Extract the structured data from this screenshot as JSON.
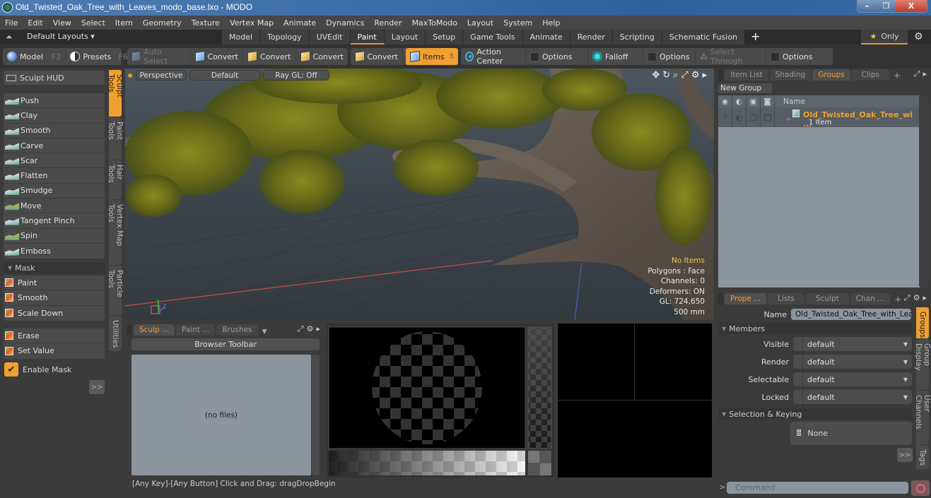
{
  "window": {
    "title": "Old_Twisted_Oak_Tree_with_Leaves_modo_base.lxo - MODO",
    "controls": {
      "minimize": "–",
      "maximize": "❐",
      "close": "X"
    }
  },
  "menu": [
    "File",
    "Edit",
    "View",
    "Select",
    "Item",
    "Geometry",
    "Texture",
    "Vertex Map",
    "Animate",
    "Dynamics",
    "Render",
    "MaxToModo",
    "Layout",
    "System",
    "Help"
  ],
  "layout_bar": {
    "layouts_label": "Default Layouts ▾",
    "tabs": [
      "Model",
      "Topology",
      "UVEdit",
      "Paint",
      "Layout",
      "Setup",
      "Game Tools",
      "Animate",
      "Render",
      "Scripting",
      "Schematic Fusion"
    ],
    "active_tab": "Paint",
    "add_tab": "+",
    "only_label": "Only",
    "only_icon": "★"
  },
  "toolbar": {
    "model": {
      "label": "Model",
      "key": "F2"
    },
    "presets": {
      "label": "Presets",
      "key": "F6"
    },
    "auto_select": "Auto Select",
    "convert_buttons": [
      "Convert",
      "Convert",
      "Convert",
      "Convert"
    ],
    "items": {
      "label": "Items",
      "key": "5"
    },
    "action_center": "Action Center",
    "options_1": "Options",
    "falloff": "Falloff",
    "options_2": "Options",
    "select_through": "Select Through",
    "options_3": "Options"
  },
  "left_panel": {
    "sculpt_hud": "Sculpt HUD",
    "sculpt_tools": [
      "Push",
      "Clay",
      "Smooth",
      "Carve",
      "Scar",
      "Flatten",
      "Smudge",
      "Move",
      "Tangent Pinch",
      "Spin",
      "Emboss"
    ],
    "mask_section": "Mask",
    "mask_tools": [
      "Paint",
      "Smooth",
      "Scale Down"
    ],
    "mask_tools_2": [
      "Erase",
      "Set Value"
    ],
    "enable_mask": {
      "label": "Enable Mask",
      "checked": true
    },
    "more": ">>"
  },
  "vertical_tabs_left": [
    "Sculpt Tools",
    "Paint Tools",
    "Hair Tools",
    "Vertex Map Tools",
    "Particle Tools",
    "Utilities"
  ],
  "vertical_tabs_left_active": "Sculpt Tools",
  "viewport": {
    "view": "Perspective",
    "shading": "Default",
    "raygl": "Ray GL: Off",
    "info": {
      "selection": "No Items",
      "polygons": "Polygons : Face",
      "channels": "Channels: 0",
      "deformers": "Deformers: ON",
      "gl": "GL: 724,650",
      "grid": "500 mm"
    },
    "axis": {
      "y": "Y",
      "z": "Z"
    }
  },
  "groups_panel": {
    "tabs": [
      "Item List",
      "Shading",
      "Groups",
      "Clips"
    ],
    "active_tab": "Groups",
    "new_group": "New Group",
    "column_name": "Name",
    "rows": [
      {
        "name": "Old_Twisted_Oak_Tree_wi ...",
        "sub": "1 Item"
      }
    ]
  },
  "properties_panel": {
    "tabs": [
      "Prope ...",
      "Lists",
      "Sculpt",
      "Chan ..."
    ],
    "active_tab": "Prope ...",
    "name_label": "Name",
    "name_value": "Old_Twisted_Oak_Tree_with_Leav",
    "members_section": "Members",
    "fields": [
      {
        "label": "Visible",
        "value": "default"
      },
      {
        "label": "Render",
        "value": "default"
      },
      {
        "label": "Selectable",
        "value": "default"
      },
      {
        "label": "Locked",
        "value": "default"
      }
    ],
    "selection_section": "Selection & Keying",
    "selection_value": "None",
    "more": ">>"
  },
  "vertical_tabs_right": [
    "Groups",
    "Group Display",
    "User Channels",
    "Tags"
  ],
  "vertical_tabs_right_active": "Groups",
  "browser_panel": {
    "tabs": [
      "Sculp ...",
      "Paint ...",
      "Brushes"
    ],
    "active_tab": "Sculp ...",
    "toolbar_button": "Browser Toolbar",
    "empty_text": "(no files)"
  },
  "status_bar": {
    "hint": "[Any Key]-[Any Button] Click and Drag:   dragDropBegin"
  },
  "command": {
    "placeholder": "Command",
    "prompt": ">"
  },
  "colors": {
    "accent": "#f0a030",
    "panel": "#3b3b3b",
    "highlight_text": "#f0c050"
  }
}
